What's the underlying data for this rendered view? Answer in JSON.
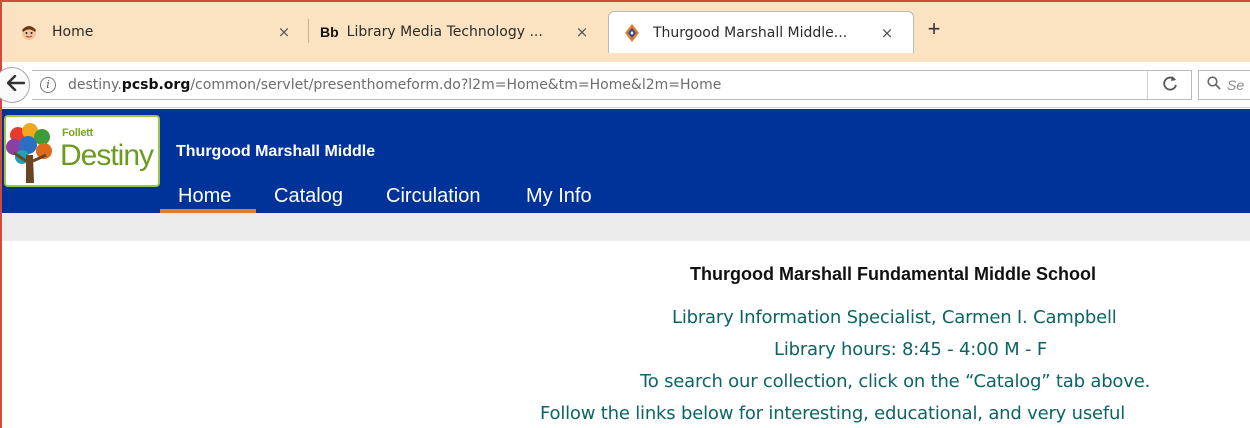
{
  "browser": {
    "tabs": [
      {
        "title": "Home",
        "icon": "avatar-favicon",
        "active": false
      },
      {
        "title": "Library Media Technology ...",
        "icon": "blackboard-favicon",
        "icon_text": "Bb",
        "active": false
      },
      {
        "title": "Thurgood Marshall Middle...",
        "icon": "destiny-favicon",
        "active": true
      }
    ],
    "close_glyph": "×",
    "new_tab_glyph": "+",
    "url": {
      "prefix": "destiny.",
      "domain": "pcsb.org",
      "path": "/common/servlet/presenthomeform.do?l2m=Home&tm=Home&l2m=Home"
    },
    "search_placeholder": "Se"
  },
  "destiny": {
    "logo_top": "Follett",
    "logo_main": "Destiny",
    "school_name": "Thurgood Marshall Middle",
    "menu": [
      {
        "label": "Home",
        "active": true
      },
      {
        "label": "Catalog",
        "active": false
      },
      {
        "label": "Circulation",
        "active": false
      },
      {
        "label": "My Info",
        "active": false
      }
    ]
  },
  "content": {
    "school_full_name": "Thurgood Marshall Fundamental Middle School",
    "lines": [
      "Library Information Specialist, Carmen I. Campbell",
      "Library hours: 8:45 - 4:00 M - F",
      "To search our collection, click on the “Catalog” tab above.",
      "Follow the links below for interesting, educational, and very useful"
    ]
  },
  "colors": {
    "header_blue": "#003399",
    "menu_accent": "#e97a24",
    "text_teal": "#0b6565",
    "tabstrip_bg": "#fbe3c1"
  }
}
